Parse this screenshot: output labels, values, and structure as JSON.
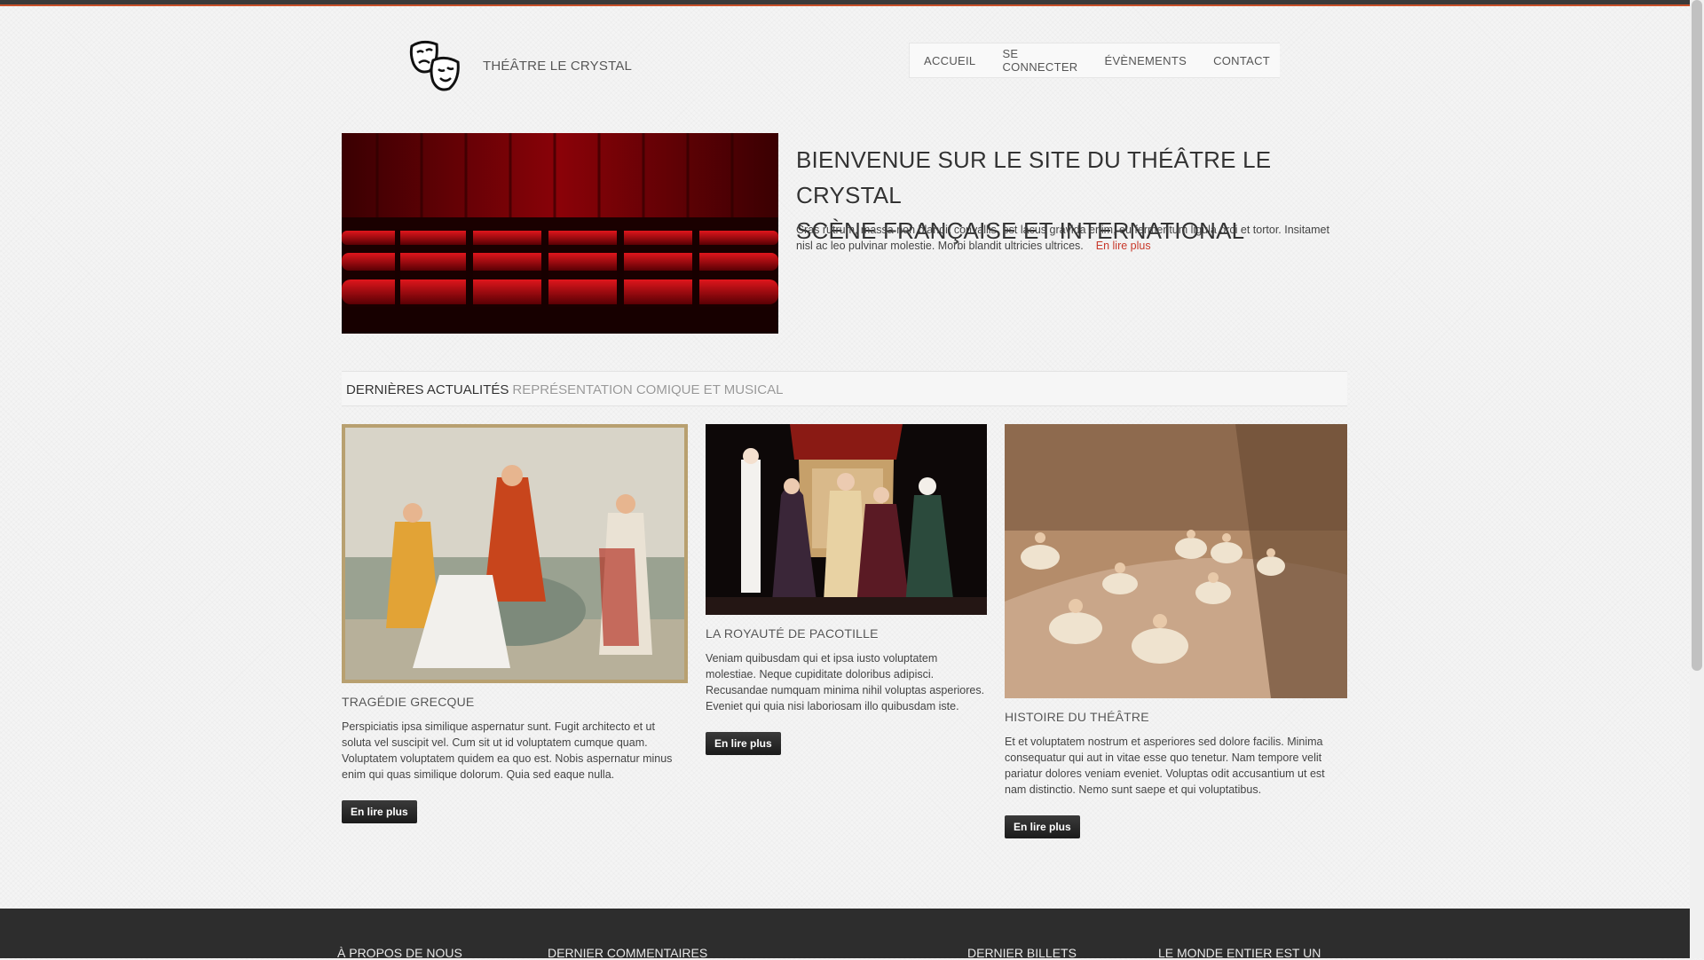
{
  "header": {
    "site_name": "THÉÂTRE LE CRYSTAL",
    "nav": [
      "ACCUEIL",
      "SE CONNECTER",
      "ÉVÈNEMENTS",
      "CONTACT"
    ]
  },
  "hero": {
    "title_line1": "BIENVENUE SUR LE SITE DU THÉÂTRE LE CRYSTAL",
    "title_line2": "SCÈNE FRANÇAISE ET INTERNATIONAL",
    "text": "Cras rutrum, massa non blandit convallis, est lacus gravida enim, eu fermentum ligula orci et tortor. Insitamet nisl ac leo pulvinar molestie. Morbi blandit ultricies ultrices.",
    "read_more": "En lire plus"
  },
  "section": {
    "title": "DERNIÈRES ACTUALITÉS",
    "subtitle": "REPRÉSENTATION COMIQUE ET MUSICAL"
  },
  "cards": [
    {
      "title": "TRAGÉDIE GRECQUE",
      "text": "Perspiciatis ipsa similique aspernatur sunt. Fugit architecto et ut soluta vel suscipit vel. Cum sit ut id voluptatem cumque quam. Voluptatem voluptatem quidem ea quo est. Nobis aspernatur minus enim qui quas similique dolorum. Quia sed eaque nulla.",
      "button": "En lire plus"
    },
    {
      "title": "LA ROYAUTÉ DE PACOTILLE",
      "text": "Veniam quibusdam qui et ipsa iusto voluptatem molestiae. Neque cupiditate doloribus adipisci. Recusandae numquam minima nihil voluptas asperiores. Eveniet qui quia nisi laboriosam illo quibusdam iste.",
      "button": "En lire plus"
    },
    {
      "title": "HISTOIRE DU THÉÂTRE",
      "text": "Et et voluptatem nostrum et asperiores sed dolore facilis. Minima consequatur qui aut in vitae esse quo tenetur. Nam tempore velit pariatur dolores veniam eveniet. Voluptas odit accusantium ut est nam distinctio. Nemo sunt saepe et qui voluptatibus.",
      "button": "En lire plus"
    }
  ],
  "footer": {
    "columns": [
      "À PROPOS DE NOUS",
      "DERNIER COMMENTAIRES",
      "DERNIER BILLETS",
      "LE MONDE ENTIER EST UN"
    ]
  },
  "colors": {
    "accent": "#c8382a",
    "footer_bg": "#2d2d2d",
    "button_bg": "#222222"
  }
}
